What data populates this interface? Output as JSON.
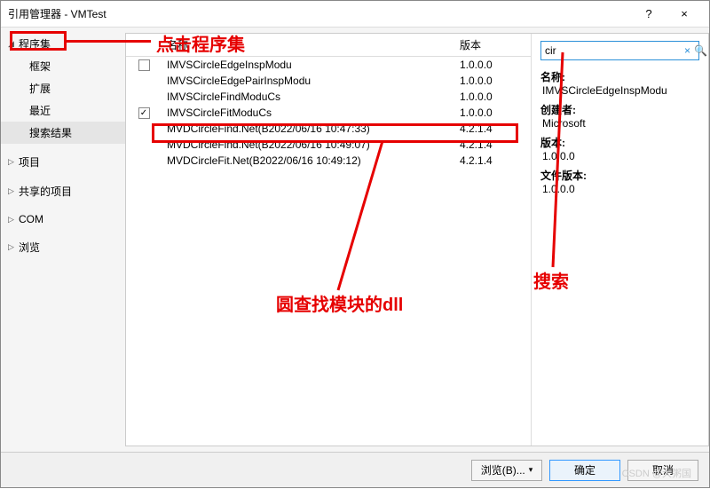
{
  "window": {
    "title": "引用管理器 - VMTest",
    "help": "?",
    "close": "×"
  },
  "sidebar": {
    "top": "程序集",
    "items": [
      "框架",
      "扩展",
      "最近",
      "搜索结果"
    ],
    "selected_index": 3,
    "groups": [
      "项目",
      "共享的项目",
      "COM",
      "浏览"
    ]
  },
  "columns": {
    "name": "名称",
    "version": "版本"
  },
  "rows": [
    {
      "checked": false,
      "showbox": true,
      "name": "IMVSCircleEdgeInspModu",
      "version": "1.0.0.0"
    },
    {
      "checked": false,
      "showbox": false,
      "name": "IMVSCircleEdgePairInspModu",
      "version": "1.0.0.0"
    },
    {
      "checked": false,
      "showbox": false,
      "name": "IMVSCircleFindModuCs",
      "version": "1.0.0.0"
    },
    {
      "checked": true,
      "showbox": true,
      "name": "IMVSCircleFitModuCs",
      "version": "1.0.0.0"
    },
    {
      "checked": false,
      "showbox": false,
      "name": "MVDCircleFind.Net(B2022/06/16 10:47:33)",
      "version": "4.2.1.4"
    },
    {
      "checked": false,
      "showbox": false,
      "name": "MVDCircleFind.Net(B2022/06/16 10:49:07)",
      "version": "4.2.1.4"
    },
    {
      "checked": false,
      "showbox": false,
      "name": "MVDCircleFit.Net(B2022/06/16 10:49:12)",
      "version": "4.2.1.4"
    }
  ],
  "search": {
    "value": "cir",
    "clear": "×",
    "icon": "🔍"
  },
  "details": {
    "name_label": "名称:",
    "name": "IMVSCircleEdgeInspModu",
    "author_label": "创建者:",
    "author": "Microsoft",
    "ver_label": "版本:",
    "ver": "1.0.0.0",
    "filever_label": "文件版本:",
    "filever": "1.0.0.0"
  },
  "footer": {
    "browse": "浏览(B)...",
    "ok": "确定",
    "cancel": "取消"
  },
  "annotations": {
    "click_assembly": "点击程序集",
    "dll": "圆查找模块的dll",
    "search": "搜索"
  },
  "watermark": "CSDN @大粥国"
}
